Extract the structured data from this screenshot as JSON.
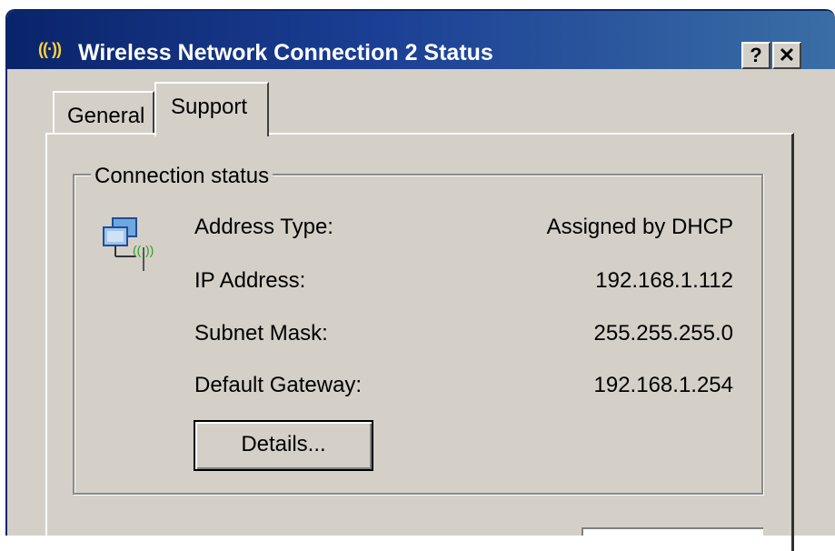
{
  "window": {
    "title": "Wireless Network Connection 2 Status",
    "title_icon": "wireless-signal-icon",
    "help_label": "?",
    "close_label": "✕"
  },
  "tabs": [
    {
      "label": "General",
      "selected": false
    },
    {
      "label": "Support",
      "selected": true
    }
  ],
  "group": {
    "legend": "Connection status",
    "icon": "network-connection-icon",
    "rows": [
      {
        "label": "Address Type:",
        "value": "Assigned by DHCP"
      },
      {
        "label": "IP Address:",
        "value": "192.168.1.112"
      },
      {
        "label": "Subnet Mask:",
        "value": "255.255.255.0"
      },
      {
        "label": "Default Gateway:",
        "value": "192.168.1.254"
      }
    ],
    "details_button": "Details..."
  },
  "colors": {
    "titlebar": "#0a246a",
    "face": "#d4d0c8",
    "signal": "#2a9d2a"
  }
}
